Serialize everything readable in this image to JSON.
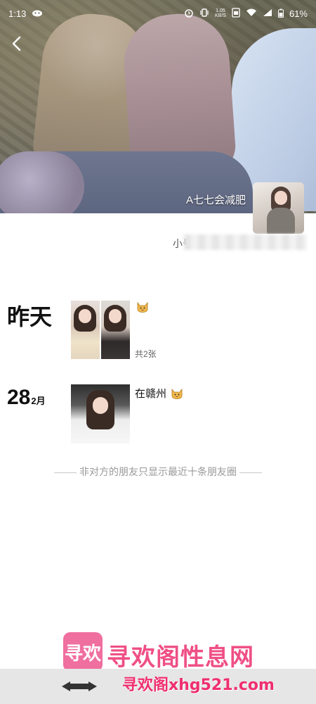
{
  "status_bar": {
    "time": "1:13",
    "net_speed_value": "1.05",
    "net_speed_unit": "KB/S",
    "battery": "61%"
  },
  "profile": {
    "name": "A七七会减肥",
    "signature_prefix": "小号"
  },
  "posts": [
    {
      "date_label": "昨天",
      "text": "",
      "photo_count": "共2张"
    },
    {
      "date_day": "28",
      "date_month": "2月",
      "text": "在赣州"
    }
  ],
  "footer_note": "非对方的朋友只显示最近十条朋友圈",
  "watermark": {
    "logo_text": "寻欢",
    "title": "寻欢阁性息网",
    "url": "寻欢阁xhg521.com"
  },
  "colors": {
    "accent_pink": "#ef4f86",
    "text_gray": "#9a9a9a"
  },
  "icons": {
    "back": "chevron-left",
    "alarm": "alarm-clock",
    "vibrate": "vibrate",
    "wifi": "wifi",
    "signal": "cell-signal",
    "battery": "battery",
    "cat_emoji": "cat-face"
  }
}
